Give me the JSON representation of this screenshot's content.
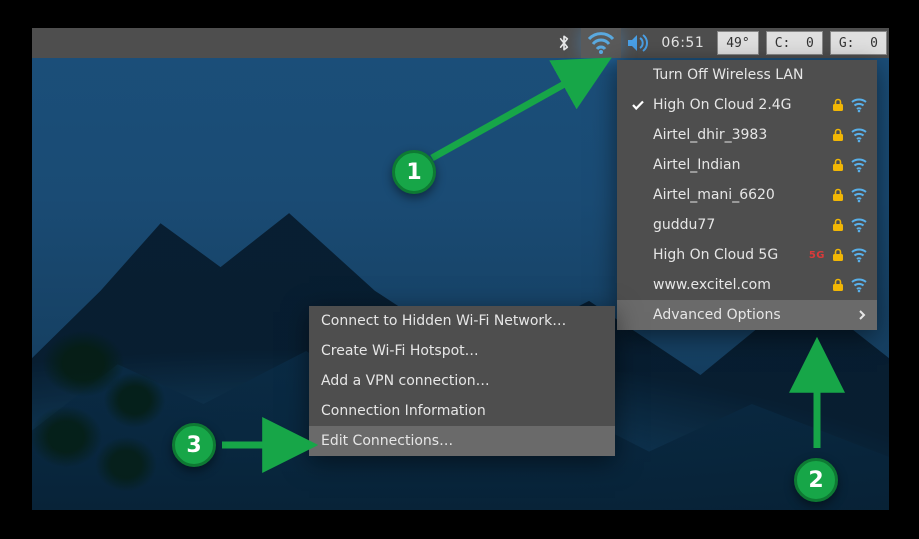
{
  "panel": {
    "clock": "06:51",
    "temp": "49°",
    "cpu_label": "C:  0",
    "gpu_label": "G:  0"
  },
  "network_menu": {
    "turn_off": "Turn Off Wireless LAN",
    "networks": [
      {
        "ssid": "High On Cloud 2.4G",
        "connected": true,
        "secured": true,
        "five_g": false
      },
      {
        "ssid": "Airtel_dhir_3983",
        "connected": false,
        "secured": true,
        "five_g": false
      },
      {
        "ssid": "Airtel_Indian",
        "connected": false,
        "secured": true,
        "five_g": false
      },
      {
        "ssid": "Airtel_mani_6620",
        "connected": false,
        "secured": true,
        "five_g": false
      },
      {
        "ssid": "guddu77",
        "connected": false,
        "secured": true,
        "five_g": false
      },
      {
        "ssid": "High On Cloud 5G",
        "connected": false,
        "secured": true,
        "five_g": true
      },
      {
        "ssid": "www.excitel.com",
        "connected": false,
        "secured": true,
        "five_g": false
      }
    ],
    "advanced": "Advanced Options"
  },
  "submenu": {
    "connect_hidden": "Connect to Hidden Wi-Fi Network…",
    "create_hotspot": "Create Wi-Fi Hotspot…",
    "add_vpn": "Add a VPN connection…",
    "conn_info": "Connection Information",
    "edit_conns": "Edit Connections…"
  },
  "annotations": {
    "step1": "1",
    "step2": "2",
    "step3": "3"
  }
}
